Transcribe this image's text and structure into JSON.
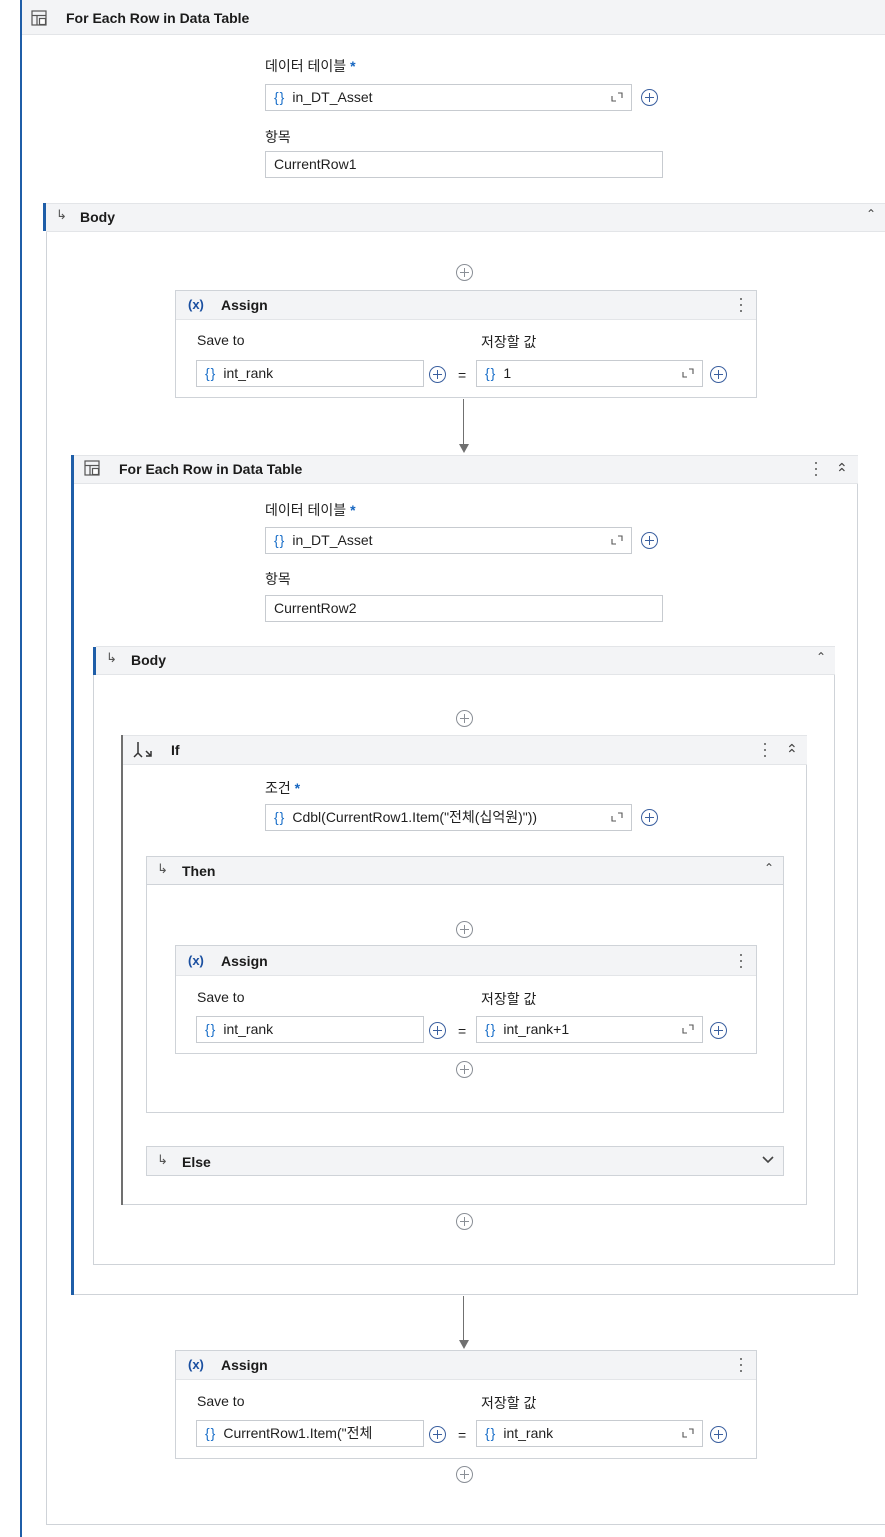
{
  "outer": {
    "title": "For Each Row in Data Table",
    "datatable_label": "데이터 테이블",
    "datatable_value": "in_DT_Asset",
    "item_label": "항목",
    "item_value": "CurrentRow1",
    "body_label": "Body"
  },
  "assign1": {
    "title": "Assign",
    "saveto_label": "Save to",
    "value_label": "저장할 값",
    "saveto_value": "int_rank",
    "value_value": "1"
  },
  "inner": {
    "title": "For Each Row in Data Table",
    "datatable_label": "데이터 테이블",
    "datatable_value": "in_DT_Asset",
    "item_label": "항목",
    "item_value": "CurrentRow2",
    "body_label": "Body"
  },
  "if_block": {
    "title": "If",
    "condition_label": "조건",
    "condition_value": "Cdbl(CurrentRow1.Item(\"전체(십억원)\"))",
    "then_label": "Then",
    "else_label": "Else"
  },
  "assign2": {
    "title": "Assign",
    "saveto_label": "Save to",
    "value_label": "저장할 값",
    "saveto_value": "int_rank",
    "value_value": "int_rank+1"
  },
  "assign3": {
    "title": "Assign",
    "saveto_label": "Save to",
    "value_label": "저장할 값",
    "saveto_value": "CurrentRow1.Item(\"전체 ",
    "value_value": "int_rank"
  },
  "common": {
    "required_mark": "*",
    "brace": "{}",
    "equals": "=",
    "assign_icon": "(x)"
  }
}
